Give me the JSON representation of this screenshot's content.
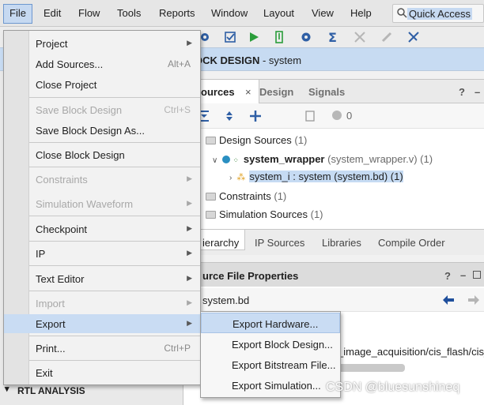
{
  "menubar": {
    "items": [
      "File",
      "Edit",
      "Flow",
      "Tools",
      "Reports",
      "Window",
      "Layout",
      "View",
      "Help"
    ],
    "quick_access": "Quick Access"
  },
  "block_design": {
    "title": "BLOCK DESIGN",
    "suffix": " - system",
    "visible_title": "OCK DESIGN"
  },
  "sources": {
    "tabs": [
      "ources",
      "Design",
      "Signals"
    ],
    "count": "0",
    "tree": {
      "design_sources": "Design Sources",
      "design_sources_count": "(1)",
      "wrapper_name": "system_wrapper",
      "wrapper_file": "(system_wrapper.v) (1)",
      "bd_instance": "system_i : system (system.bd) (1)",
      "constraints": "Constraints",
      "constraints_count": "(1)",
      "sim_sources": "Simulation Sources",
      "sim_sources_count": "(1)"
    },
    "bottom_tabs": [
      "ierarchy",
      "IP Sources",
      "Libraries",
      "Compile Order"
    ]
  },
  "properties": {
    "title": "urce File Properties",
    "file": "system.bd",
    "path": "_image_acquisition/cis_flash/cis_f"
  },
  "left_panel": {
    "rtl_analysis": "RTL ANALYSIS"
  },
  "file_menu": {
    "project": "Project",
    "add_sources": "Add Sources...",
    "add_sources_sc": "Alt+A",
    "close_project": "Close Project",
    "save_block_design": "Save Block Design",
    "save_block_design_sc": "Ctrl+S",
    "save_block_design_as": "Save Block Design As...",
    "close_block_design": "Close Block Design",
    "constraints": "Constraints",
    "simulation_waveform": "Simulation Waveform",
    "checkpoint": "Checkpoint",
    "ip": "IP",
    "text_editor": "Text Editor",
    "import": "Import",
    "export": "Export",
    "print": "Print...",
    "print_sc": "Ctrl+P",
    "exit": "Exit"
  },
  "export_menu": {
    "items": [
      "Export Hardware...",
      "Export Block Design...",
      "Export Bitstream File...",
      "Export Simulation..."
    ]
  },
  "watermark": "CSDN @bluesunshineq",
  "colors": {
    "selection": "#c9dcf3",
    "header_blue": "#c7dbf2",
    "menu_bg": "#f2f2f2"
  }
}
